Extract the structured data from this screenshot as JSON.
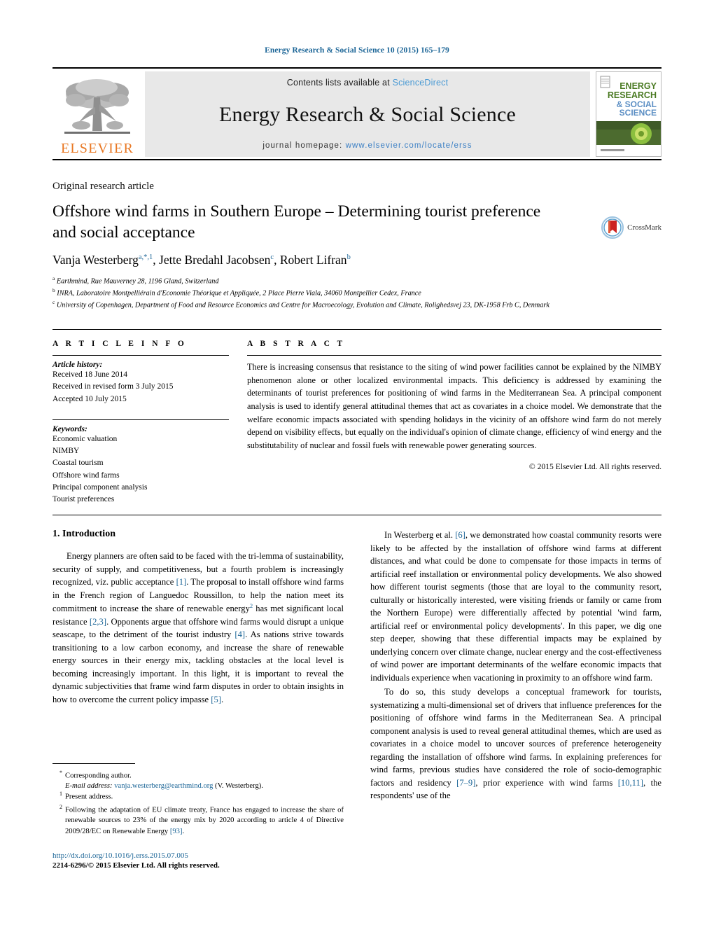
{
  "running_head": "Energy Research & Social Science 10 (2015) 165–179",
  "masthead": {
    "publisher_name": "ELSEVIER",
    "contents_prefix": "Contents lists available at",
    "contents_link": "ScienceDirect",
    "journal_title": "Energy Research & Social Science",
    "homepage_label": "journal homepage:",
    "homepage_url": "www.elsevier.com/locate/erss",
    "cover": {
      "line1": "ENERGY",
      "line2": "RESEARCH",
      "line3": "& SOCIAL",
      "line4": "SCIENCE"
    },
    "link_color": "#4a9ad4"
  },
  "article": {
    "type": "Original research article",
    "title": "Offshore wind farms in Southern Europe – Determining tourist preference and social acceptance",
    "crossmark_label": "CrossMark",
    "authors": [
      {
        "name": "Vanja Westerberg",
        "marks": "a,*,1"
      },
      {
        "name": "Jette Bredahl Jacobsen",
        "marks": "c"
      },
      {
        "name": "Robert Lifran",
        "marks": "b"
      }
    ],
    "affiliations": [
      {
        "mark": "a",
        "text": "Earthmind, Rue Mauverney 28, 1196 Gland, Switzerland"
      },
      {
        "mark": "b",
        "text": "INRA, Laboratoire Montpelliérain d'Economie Théorique et Appliquée, 2 Place Pierre Viala, 34060 Montpellier Cedex, France"
      },
      {
        "mark": "c",
        "text": "University of Copenhagen, Department of Food and Resource Economics and Centre for Macroecology, Evolution and Climate, Rolighedsvej 23, DK-1958 Frb C, Denmark"
      }
    ]
  },
  "info": {
    "heading": "A R T I C L E    I N F O",
    "history_label": "Article history:",
    "history": [
      "Received 18 June 2014",
      "Received in revised form 3 July 2015",
      "Accepted 10 July 2015"
    ],
    "keywords_label": "Keywords:",
    "keywords": [
      "Economic valuation",
      "NIMBY",
      "Coastal tourism",
      "Offshore wind farms",
      "Principal component analysis",
      "Tourist preferences"
    ]
  },
  "abstract": {
    "heading": "A B S T R A C T",
    "text": "There is increasing consensus that resistance to the siting of wind power facilities cannot be explained by the NIMBY phenomenon alone or other localized environmental impacts. This deficiency is addressed by examining the determinants of tourist preferences for positioning of wind farms in the Mediterranean Sea. A principal component analysis is used to identify general attitudinal themes that act as covariates in a choice model. We demonstrate that the welfare economic impacts associated with spending holidays in the vicinity of an offshore wind farm do not merely depend on visibility effects, but equally on the individual's opinion of climate change, efficiency of wind energy and the substitutability of nuclear and fossil fuels with renewable power generating sources.",
    "copyright": "© 2015 Elsevier Ltd. All rights reserved."
  },
  "body": {
    "section_number_title": "1.  Introduction",
    "left_paragraph_parts": {
      "p1_a": "Energy planners are often said to be faced with the tri-lemma of sustainability, security of supply, and competitiveness, but a fourth problem is increasingly recognized, viz. public acceptance ",
      "p1_ref1": "[1]",
      "p1_b": ". The proposal to install offshore wind farms in the French region of Languedoc Roussillon, to help the nation meet its commitment to increase the share of renewable energy",
      "p1_sup": "2",
      "p1_c": " has met significant local resistance ",
      "p1_ref2": "[2,3]",
      "p1_d": ". Opponents argue that offshore wind farms would disrupt a unique seascape, to the detriment of the tourist industry ",
      "p1_ref3": "[4]",
      "p1_e": ". As nations strive towards transitioning to a low carbon economy, and increase the share of renewable energy sources in their energy mix, tackling obstacles at the local level is becoming increasingly important. In this light, it is important to reveal the dynamic subjectivities that frame wind farm disputes in order to obtain insights in how to overcome the current policy impasse ",
      "p1_ref4": "[5]",
      "p1_f": "."
    },
    "right_paragraph_parts": {
      "p2_a": "In Westerberg et al. ",
      "p2_ref1": "[6]",
      "p2_b": ", we demonstrated how coastal community resorts were likely to be affected by the installation of offshore wind farms at different distances, and what could be done to compensate for those impacts in terms of artificial reef installation or environmental policy developments. We also showed how different tourist segments (those that are loyal to the community resort, culturally or historically interested, were visiting friends or family or came from the Northern Europe) were differentially affected by potential 'wind farm, artificial reef or environmental policy developments'. In this paper, we dig one step deeper, showing that these differential impacts may be explained by underlying concern over climate change, nuclear energy and the cost-effectiveness of wind power are important determinants of the welfare economic impacts that individuals experience when vacationing in proximity to an offshore wind farm.",
      "p3_a": "To do so, this study develops a conceptual framework for tourists, systematizing a multi-dimensional set of drivers that influence preferences for the positioning of offshore wind farms in the Mediterranean Sea. A principal component analysis is used to reveal general attitudinal themes, which are used as covariates in a choice model to uncover sources of preference heterogeneity regarding the installation of offshore wind farms. In explaining preferences for wind farms, previous studies have considered the role of socio-demographic factors and residency ",
      "p3_ref1": "[7–9]",
      "p3_b": ", prior experience with wind farms ",
      "p3_ref2": "[10,11]",
      "p3_c": ", the respondents' use of the"
    }
  },
  "footnotes": {
    "corresponding_marker": "*",
    "corresponding_text": "Corresponding author.",
    "email_label": "E-mail address:",
    "email_address": "vanja.westerberg@earthmind.org",
    "email_suffix": "(V. Westerberg).",
    "fn1_marker": "1",
    "fn1_text": "Present address.",
    "fn2_marker": "2",
    "fn2_text": "Following the adaptation of EU climate treaty, France has engaged to increase the share of renewable sources to 23% of the energy mix by 2020 according to article 4 of Directive 2009/28/EC on Renewable Energy ",
    "fn2_ref": "[93]",
    "fn2_tail": "."
  },
  "imprint": {
    "doi": "http://dx.doi.org/10.1016/j.erss.2015.07.005",
    "issn_line": "2214-6296/© 2015 Elsevier Ltd. All rights reserved."
  },
  "colors": {
    "link": "#1a6496",
    "elsevier_orange": "#E87722",
    "band_gray": "#e8e8e8"
  }
}
